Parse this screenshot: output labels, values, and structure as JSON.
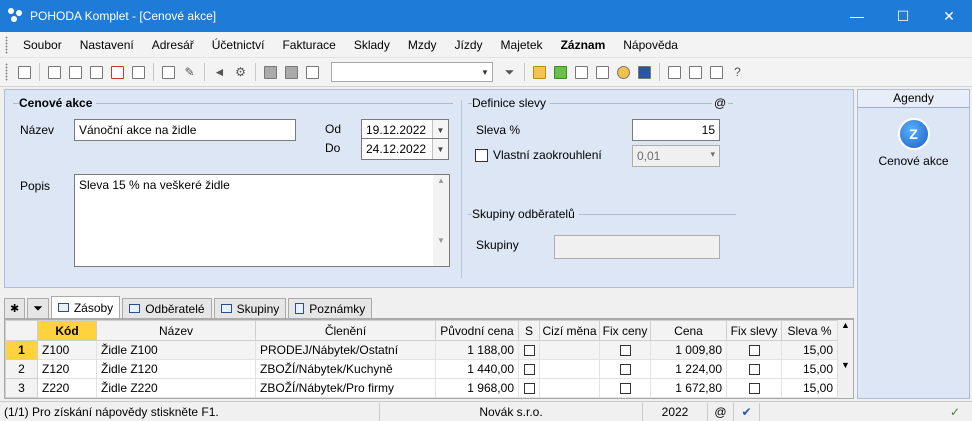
{
  "window": {
    "title": "POHODA Komplet - [Cenové akce]",
    "minimize": "—",
    "maximize": "☐",
    "close": "✕"
  },
  "menu": [
    "Soubor",
    "Nastavení",
    "Adresář",
    "Účetnictví",
    "Fakturace",
    "Sklady",
    "Mzdy",
    "Jízdy",
    "Majetek",
    "Záznam",
    "Nápověda"
  ],
  "form": {
    "cenove_akce_title": "Cenové akce",
    "nazev_label": "Název",
    "nazev_value": "Vánoční akce na židle",
    "od_label": "Od",
    "od_value": "19.12.2022",
    "do_label": "Do",
    "do_value": "24.12.2022",
    "popis_label": "Popis",
    "popis_value": "Sleva 15 % na veškeré židle",
    "definice_title": "Definice slevy",
    "at_symbol": "@",
    "sleva_label": "Sleva %",
    "sleva_value": "15",
    "vlastni_label": "Vlastní zaokrouhlení",
    "vlastni_value": "0,01",
    "skupiny_title": "Skupiny odběratelů",
    "skupiny_label": "Skupiny",
    "skupiny_value": ""
  },
  "tabs": [
    "Zásoby",
    "Odběratelé",
    "Skupiny",
    "Poznámky"
  ],
  "table": {
    "columns": [
      "Kód",
      "Název",
      "Členění",
      "Původní cena",
      "S",
      "Cizí měna",
      "Fix ceny",
      "Cena",
      "Fix slevy",
      "Sleva %"
    ],
    "rows": [
      {
        "n": "1",
        "kod": "Z100",
        "nazev": "Židle Z100",
        "cleneni": "PRODEJ/Nábytek/Ostatní",
        "puvodni": "1 188,00",
        "cena": "1 009,80",
        "sleva": "15,00"
      },
      {
        "n": "2",
        "kod": "Z120",
        "nazev": "Židle Z120",
        "cleneni": "ZBOŽÍ/Nábytek/Kuchyně",
        "puvodni": "1 440,00",
        "cena": "1 224,00",
        "sleva": "15,00"
      },
      {
        "n": "3",
        "kod": "Z220",
        "nazev": "Židle Z220",
        "cleneni": "ZBOŽÍ/Nábytek/Pro firmy",
        "puvodni": "1 968,00",
        "cena": "1 672,80",
        "sleva": "15,00"
      }
    ]
  },
  "agendy": {
    "title": "Agendy",
    "item": "Cenové akce"
  },
  "status": {
    "help": "(1/1) Pro získání nápovědy stiskněte F1.",
    "company": "Novák s.r.o.",
    "year": "2022",
    "at": "@"
  }
}
